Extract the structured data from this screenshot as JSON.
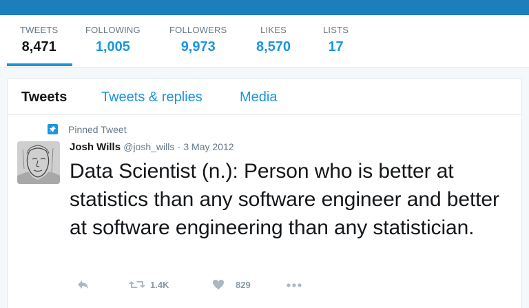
{
  "profile_stats": [
    {
      "label": "TWEETS",
      "value": "8,471",
      "active": true
    },
    {
      "label": "FOLLOWING",
      "value": "1,005",
      "active": false
    },
    {
      "label": "FOLLOWERS",
      "value": "9,973",
      "active": false
    },
    {
      "label": "LIKES",
      "value": "8,570",
      "active": false
    },
    {
      "label": "LISTS",
      "value": "17",
      "active": false
    }
  ],
  "tabs": [
    {
      "label": "Tweets",
      "active": true
    },
    {
      "label": "Tweets & replies",
      "active": false
    },
    {
      "label": "Media",
      "active": false
    }
  ],
  "pinned_tweet": {
    "pinned_label": "Pinned Tweet",
    "author_name": "Josh Wills",
    "author_handle": "@josh_wills",
    "separator": "·",
    "date": "3 May 2012",
    "text": "Data Scientist (n.): Person who is better at statistics than any software engineer and better at software engineering than any statistician.",
    "actions": {
      "reply_icon": "reply-icon",
      "retweet_icon": "retweet-icon",
      "retweet_count": "1.4K",
      "like_icon": "heart-icon",
      "like_count": "829",
      "more_icon": "more-icon"
    }
  },
  "colors": {
    "brand_blue": "#1b95e0",
    "header_bar": "#1b7fbd",
    "muted_text": "#657786",
    "action_gray": "#8899a6"
  }
}
